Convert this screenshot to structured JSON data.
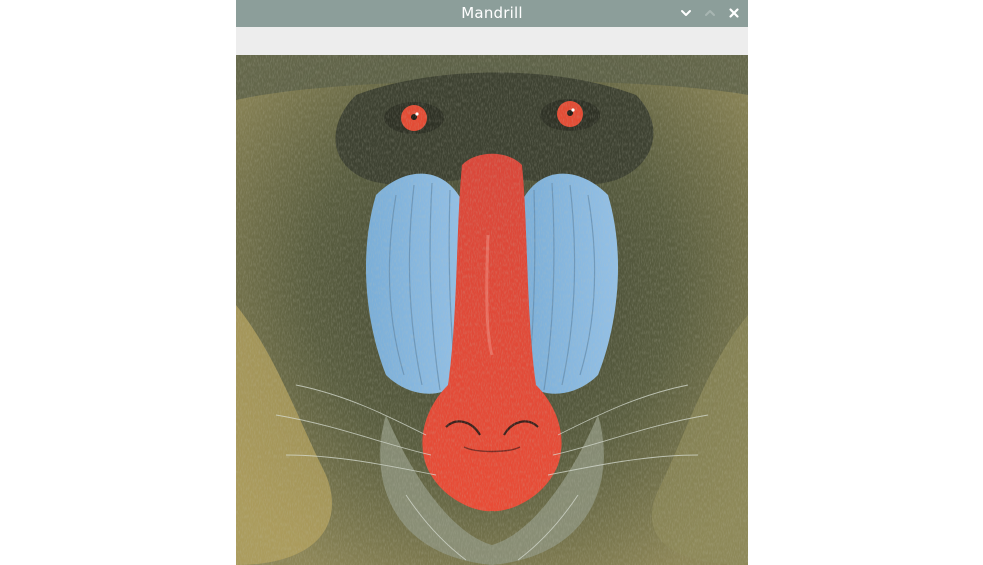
{
  "window": {
    "title": "Mandrill",
    "controls": {
      "minimize_icon": "chevron-down-icon",
      "maximize_icon": "chevron-up-icon",
      "close_icon": "close-icon"
    }
  },
  "colors": {
    "titlebar": "#8c9e9a",
    "title_text": "#ffffff",
    "fur_dark": "#4a4d38",
    "fur_olive": "#7d7b52",
    "fur_tan": "#b8a868",
    "cheek_blue": "#86b6e0",
    "nose_red": "#e24a37",
    "eye_red": "#e34b34",
    "whisker_light": "#c8d0c4"
  }
}
